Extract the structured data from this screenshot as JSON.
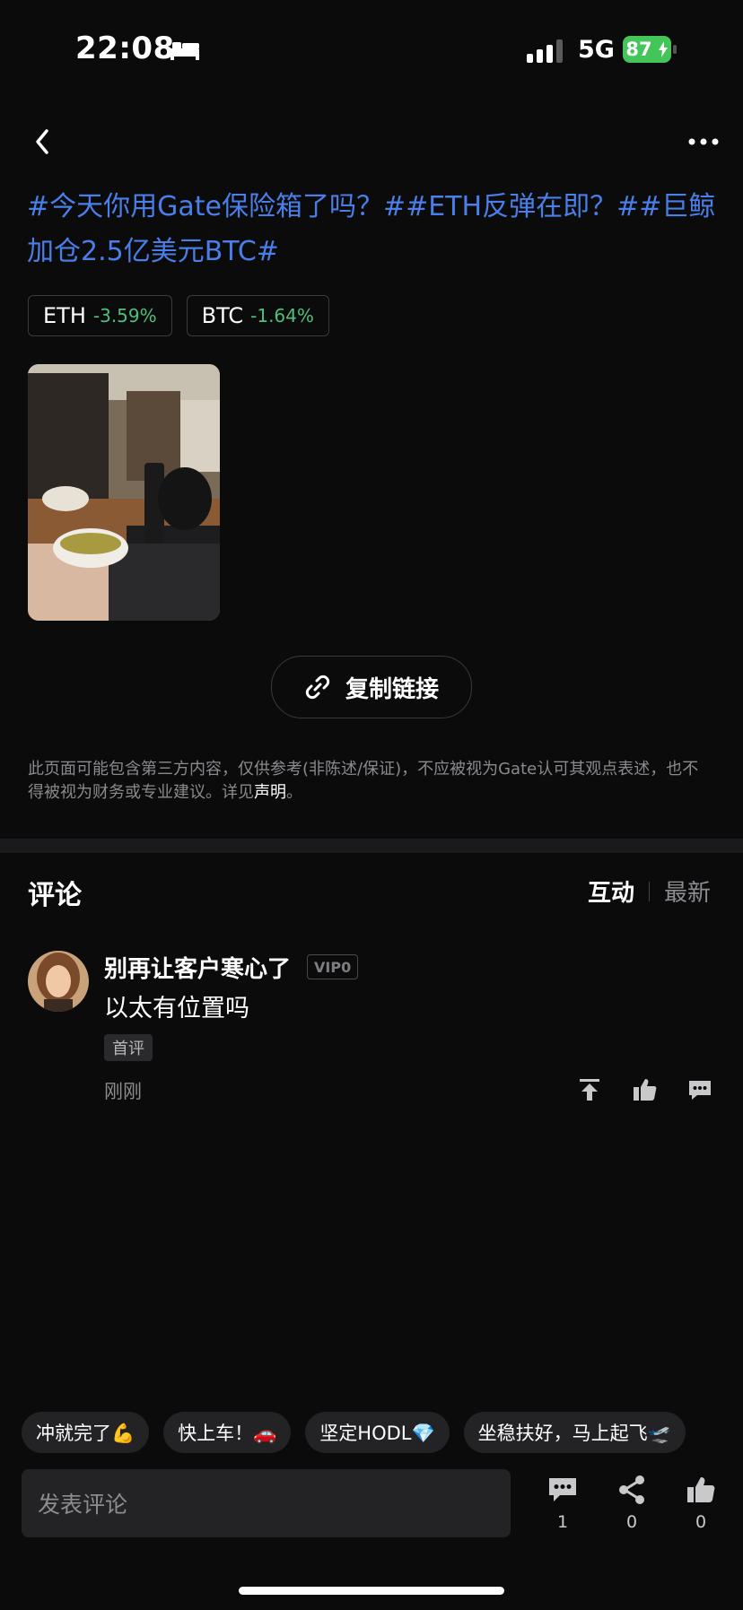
{
  "status_bar": {
    "time": "22:08",
    "network": "5G",
    "battery": "87",
    "battery_color": "#43c55a"
  },
  "post": {
    "title": "#今天你用Gate保险箱了吗？##ETH反弹在即？##巨鲸加仓2.5亿美元BTC#",
    "coins": [
      {
        "name": "ETH",
        "change": "-3.59%"
      },
      {
        "name": "BTC",
        "change": "-1.64%"
      }
    ],
    "copy_link_label": "复制链接",
    "disclaimer": "此页面可能包含第三方内容，仅供参考(非陈述/保证)，不应被视为Gate认可其观点表述，也不得被视为财务或专业建议。详见",
    "disclaimer_link": "声明",
    "disclaimer_end": "。"
  },
  "comments": {
    "title": "评论",
    "sort_active": "互动",
    "sort_inactive": "最新",
    "items": [
      {
        "author": "别再让客户寒心了",
        "vip": "VIP0",
        "text": "以太有位置吗",
        "badge": "首评",
        "time": "刚刚"
      }
    ]
  },
  "quick_replies": [
    "冲就完了💪",
    "快上车！🚗",
    "坚定HODL💎",
    "坐稳扶好，马上起飞🛫"
  ],
  "bottom_bar": {
    "input_placeholder": "发表评论",
    "comment_count": "1",
    "share_count": "0",
    "like_count": "0"
  },
  "colors": {
    "accent_blue": "#4a7ee8",
    "change_color": "#4fbf7f",
    "background": "#0b0b0c"
  }
}
